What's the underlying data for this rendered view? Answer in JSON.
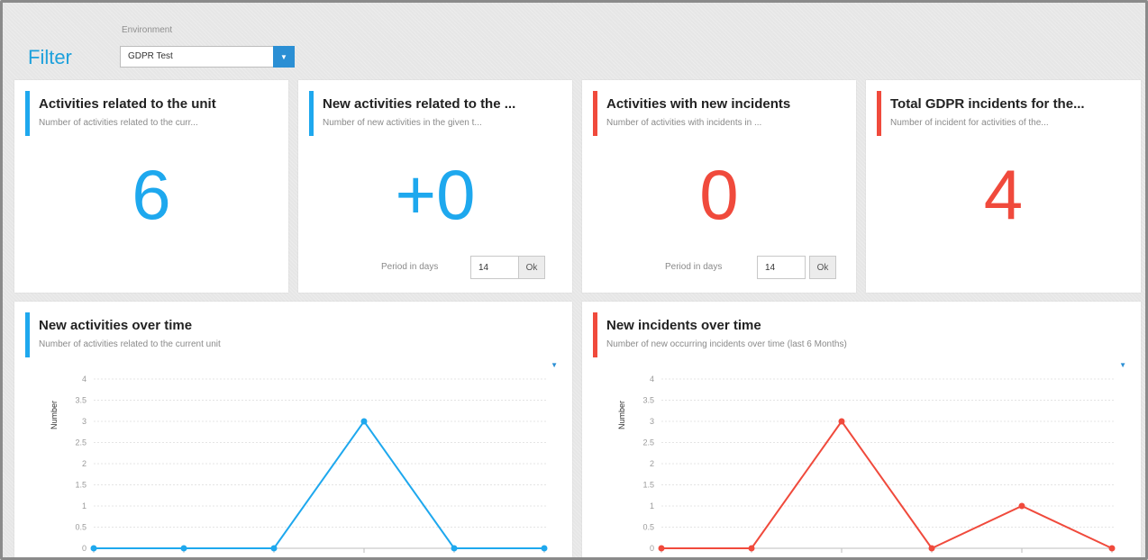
{
  "filter": {
    "title": "Filter",
    "environment_label": "Environment",
    "environment_value": "GDPR Test"
  },
  "kpis": [
    {
      "title": "Activities related to the unit",
      "subtitle": "Number of activities related to the curr...",
      "value": "6",
      "color": "#1ea8ee"
    },
    {
      "title": "New activities related to the ...",
      "subtitle": "Number of new activities in the given t...",
      "value": "+0",
      "color": "#1ea8ee",
      "period_label": "Period in days",
      "period_value": "14",
      "ok_label": "Ok"
    },
    {
      "title": "Activities with new incidents",
      "subtitle": "Number of activities with incidents in ...",
      "value": "0",
      "color": "#f04a3c",
      "period_label": "Period in days",
      "period_value": "14",
      "ok_label": "Ok"
    },
    {
      "title": "Total GDPR incidents for the...",
      "subtitle": "Number of incident for activities of the...",
      "value": "4",
      "color": "#f04a3c"
    }
  ],
  "charts": [
    {
      "title": "New activities over time",
      "subtitle": "Number of activities related to the current unit",
      "color": "#1ea8ee"
    },
    {
      "title": "New incidents over time",
      "subtitle": "Number of new occurring incidents over time (last 6 Months)",
      "color": "#f04a3c"
    }
  ],
  "chart_data": [
    {
      "type": "line",
      "title": "New activities over time",
      "ylabel": "Number",
      "ylim": [
        0,
        4
      ],
      "yticks": [
        "0",
        "0.5",
        "1",
        "1.5",
        "2",
        "2.5",
        "3",
        "3.5",
        "4"
      ],
      "series": [
        {
          "values": [
            0,
            0,
            0,
            3,
            0,
            0
          ]
        }
      ],
      "grid": true
    },
    {
      "type": "line",
      "title": "New incidents over time",
      "ylabel": "Number",
      "ylim": [
        0,
        4
      ],
      "yticks": [
        "0",
        "0.5",
        "1",
        "1.5",
        "2",
        "2.5",
        "3",
        "3.5",
        "4"
      ],
      "series": [
        {
          "values": [
            0,
            0,
            3,
            0,
            1,
            0
          ]
        }
      ],
      "grid": true
    }
  ]
}
